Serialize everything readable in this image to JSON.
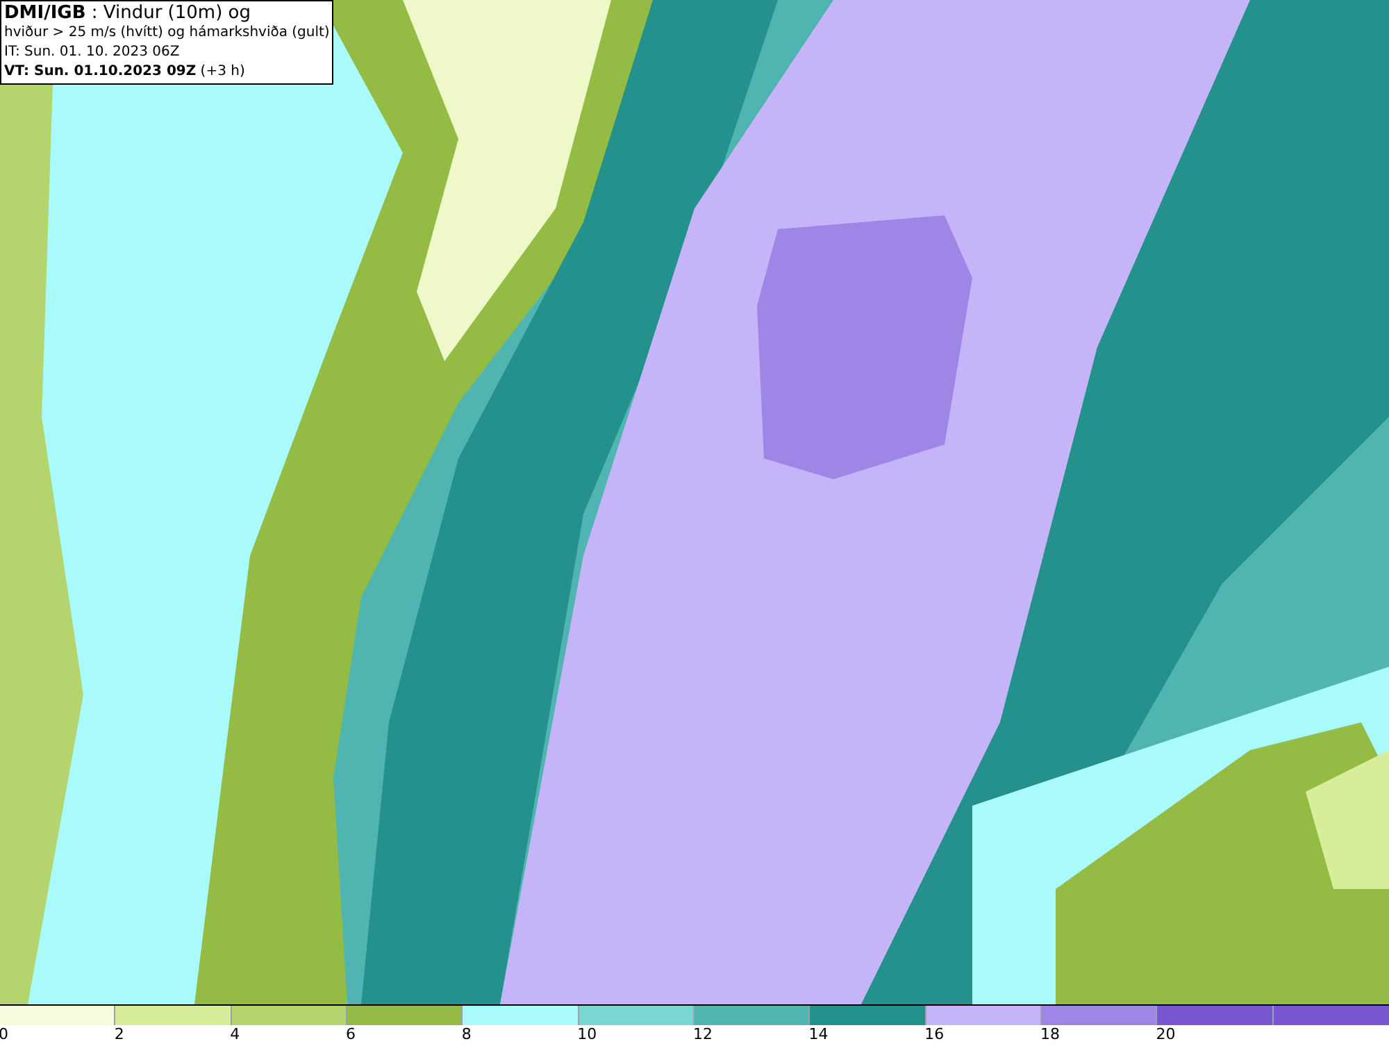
{
  "title_box": {
    "lines": [
      "**DMI/IGB** : Vindur (10m) og",
      "hviður > 25 m/s (hvítt) og hámarkshviða (gult)",
      "IT: Sun. 01. 10. 2023 06Z",
      "**VT: Sun. 01.10.2023 09Z** (+3 h)"
    ]
  },
  "legend": {
    "segments": [
      {
        "color": "#f6fbdb",
        "label": "0"
      },
      {
        "color": "#d8ed99",
        "label": "2"
      },
      {
        "color": "#b4d46e",
        "label": "4"
      },
      {
        "color": "#94bc45",
        "label": "6"
      },
      {
        "color": "#a9fafa",
        "label": "8"
      },
      {
        "color": "#7ad6d3",
        "label": "10"
      },
      {
        "color": "#50b5b1",
        "label": "12"
      },
      {
        "color": "#24918c",
        "label": "14"
      },
      {
        "color": "#c5b4f8",
        "label": "16"
      },
      {
        "color": "#9e86e6",
        "label": "18"
      },
      {
        "color": "#7955cf",
        "label": "20"
      }
    ]
  }
}
